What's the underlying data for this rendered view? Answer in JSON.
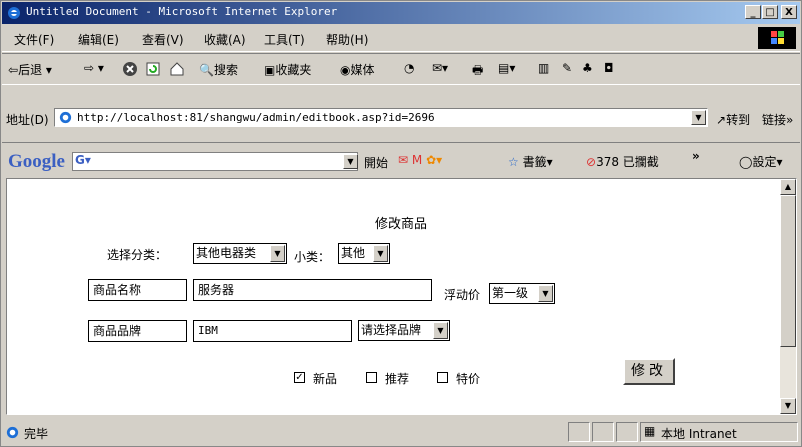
{
  "window": {
    "title": "Untitled Document - Microsoft Internet Explorer",
    "min_label": "_",
    "max_label": "□",
    "close_label": "X"
  },
  "menu": {
    "items": [
      "文件(F)",
      "编辑(E)",
      "查看(V)",
      "收藏(A)",
      "工具(T)",
      "帮助(H)"
    ]
  },
  "toolbar": {
    "back_label": "后退",
    "search_label": "搜索",
    "favorites_label": "收藏夹",
    "media_label": "媒体"
  },
  "address": {
    "label": "地址(D)",
    "url": "http://localhost:81/shangwu/admin/editbook.asp?id=2696",
    "go_label": "转到",
    "links_label": "链接"
  },
  "google": {
    "logo": "Google",
    "start_label": "開始",
    "bookmarks_label": "書籤",
    "blocked_label": "378 已攔截",
    "settings_label": "設定"
  },
  "form": {
    "heading": "修改商品",
    "category_label": "选择分类：",
    "category_value": "其他电器类",
    "subcategory_label": "小类：",
    "subcategory_value": "其他",
    "name_label": "商品名称",
    "name_value": "服务器",
    "float_price_label": "浮动价",
    "float_price_value": "第一级",
    "brand_label": "商品品牌",
    "brand_value": "IBM",
    "brand_select": "请选择品牌",
    "new_label": "新品",
    "new_checked": true,
    "recommend_label": "推荐",
    "recommend_checked": false,
    "special_label": "特价",
    "special_checked": false,
    "submit_label": "修改"
  },
  "status": {
    "text": "完毕",
    "zone": "本地 Intranet"
  },
  "colors": {
    "title_start": "#0a246a",
    "title_end": "#a6caf0",
    "chrome": "#d4d0c8"
  }
}
